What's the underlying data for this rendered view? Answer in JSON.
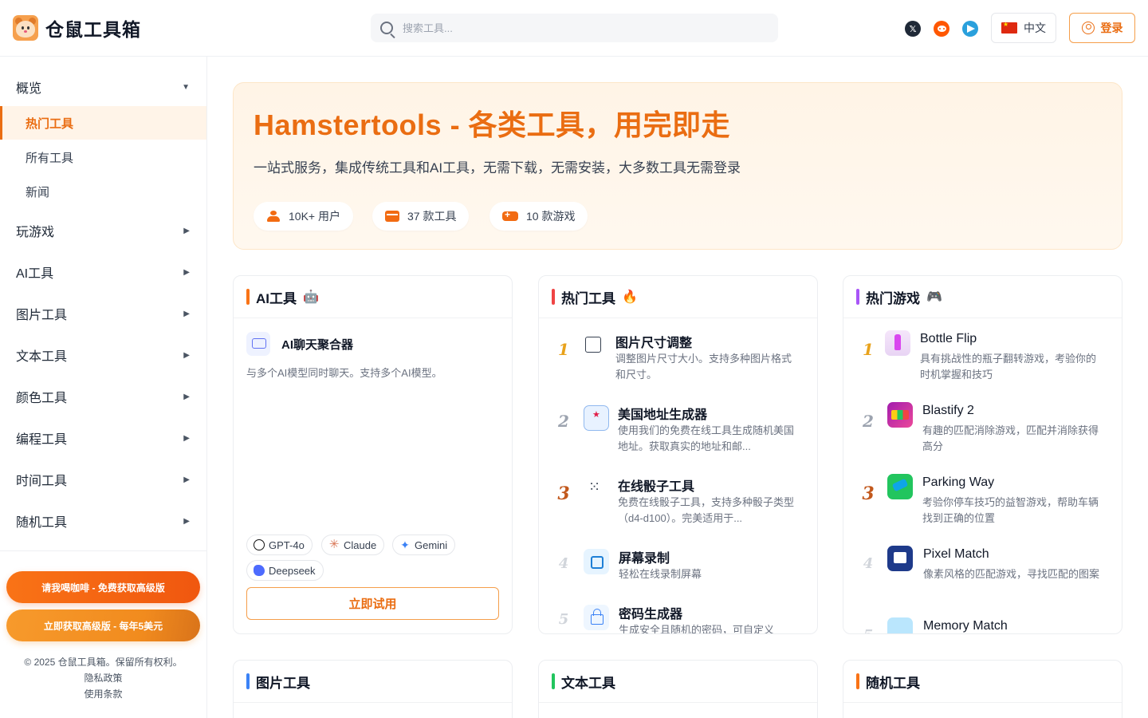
{
  "header": {
    "logo_text": "仓鼠工具箱",
    "search_placeholder": "搜索工具...",
    "lang_label": "中文",
    "login_label": "登录"
  },
  "sidebar": {
    "overview": "概览",
    "subs": [
      "热门工具",
      "所有工具",
      "新闻"
    ],
    "groups": [
      "玩游戏",
      "AI工具",
      "图片工具",
      "文本工具",
      "颜色工具",
      "编程工具",
      "时间工具",
      "随机工具"
    ],
    "promo_coffee": "请我喝咖啡 - 免费获取高级版",
    "promo_premium": "立即获取高级版 - 每年5美元",
    "copyright": "© 2025 仓鼠工具箱。保留所有权利。",
    "privacy": "隐私政策",
    "terms": "使用条款"
  },
  "hero": {
    "title": "Hamstertools - 各类工具，用完即走",
    "subtitle": "一站式服务，集成传统工具和AI工具，无需下载，无需安装，大多数工具无需登录",
    "stats": [
      "10K+ 用户",
      "37 款工具",
      "10 款游戏"
    ]
  },
  "ai_card": {
    "title": "AI工具",
    "emoji": "🤖",
    "item_name": "AI聊天聚合器",
    "item_desc": "与多个AI模型同时聊天。支持多个AI模型。",
    "models": [
      "GPT-4o",
      "Claude",
      "Gemini",
      "Deepseek"
    ],
    "try_label": "立即试用"
  },
  "hot_tools": {
    "title": "热门工具",
    "emoji": "🔥",
    "items": [
      {
        "rank": "1",
        "name": "图片尺寸调整",
        "desc": "调整图片尺寸大小。支持多种图片格式和尺寸。"
      },
      {
        "rank": "2",
        "name": "美国地址生成器",
        "desc": "使用我们的免费在线工具生成随机美国地址。获取真实的地址和邮..."
      },
      {
        "rank": "3",
        "name": "在线骰子工具",
        "desc": "免费在线骰子工具，支持多种骰子类型（d4-d100）。完美适用于..."
      },
      {
        "rank": "4",
        "name": "屏幕录制",
        "desc": "轻松在线录制屏幕"
      },
      {
        "rank": "5",
        "name": "密码生成器",
        "desc": "生成安全且随机的密码，可自定义"
      }
    ]
  },
  "hot_games": {
    "title": "热门游戏",
    "emoji": "🎮",
    "items": [
      {
        "rank": "1",
        "name": "Bottle Flip",
        "desc": "具有挑战性的瓶子翻转游戏，考验你的时机掌握和技巧"
      },
      {
        "rank": "2",
        "name": "Blastify 2",
        "desc": "有趣的匹配消除游戏，匹配并消除获得高分"
      },
      {
        "rank": "3",
        "name": "Parking Way",
        "desc": "考验你停车技巧的益智游戏，帮助车辆找到正确的位置"
      },
      {
        "rank": "4",
        "name": "Pixel Match",
        "desc": "像素风格的匹配游戏，寻找匹配的图案"
      },
      {
        "rank": "5",
        "name": "Memory Match",
        "desc": ""
      }
    ]
  },
  "bottom_cards": [
    "图片工具",
    "文本工具",
    "随机工具"
  ],
  "colors": {
    "accent": "#ea6d12",
    "ai_bar": "#f97316",
    "tools_bar": "#ef4444",
    "games_bar": "#a855f7",
    "image_bar": "#3b82f6",
    "text_bar": "#22c55e",
    "random_bar": "#f97316"
  }
}
